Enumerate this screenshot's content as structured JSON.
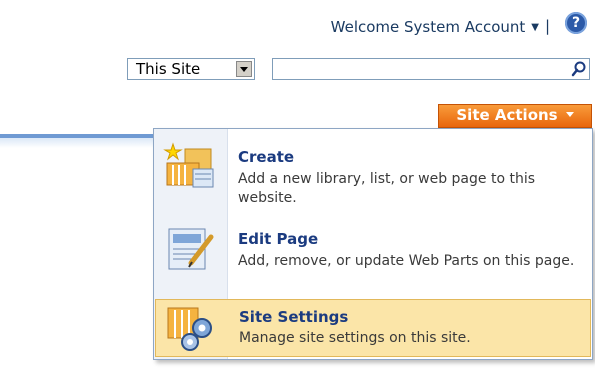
{
  "header": {
    "welcome_label": "Welcome System Account",
    "separator": "|",
    "help_glyph": "?"
  },
  "search": {
    "scope_value": "This Site",
    "query_value": "",
    "search_icon": "magnifier-icon"
  },
  "site_actions": {
    "label": "Site Actions"
  },
  "menu": {
    "items": [
      {
        "title": "Create",
        "description": "Add a new library, list, or web page to this website.",
        "icon": "create-icon"
      },
      {
        "title": "Edit Page",
        "description": "Add, remove, or update Web Parts on this page.",
        "icon": "edit-page-icon"
      },
      {
        "title": "Site Settings",
        "description": "Manage site settings on this site.",
        "icon": "site-settings-icon"
      }
    ]
  },
  "colors": {
    "site_actions_bg": "#e8660d",
    "menu_selected_bg": "#fbe5a8",
    "link_blue": "#1b3b80"
  }
}
